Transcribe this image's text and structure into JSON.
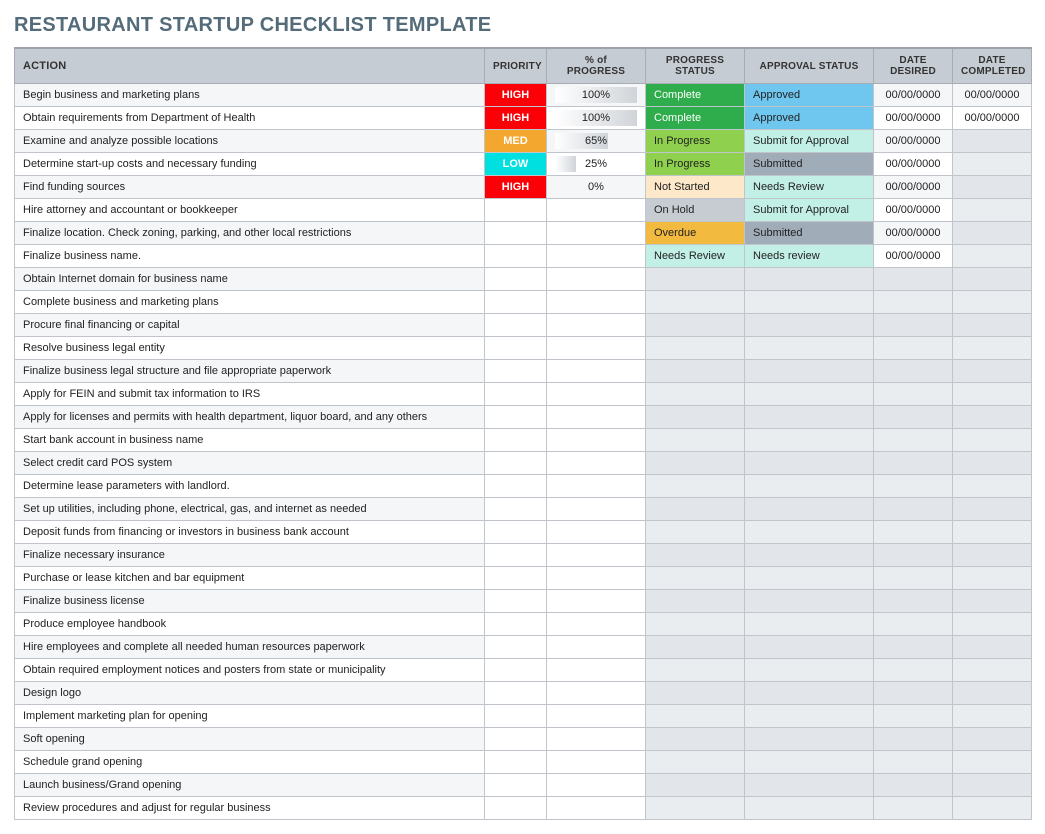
{
  "title": "RESTAURANT STARTUP CHECKLIST TEMPLATE",
  "headers": {
    "action": "ACTION",
    "priority": "PRIORITY",
    "progress": "% of PROGRESS",
    "progress_status": "PROGRESS STATUS",
    "approval_status": "APPROVAL STATUS",
    "date_desired": "DATE DESIRED",
    "date_completed": "DATE COMPLETED"
  },
  "rows": [
    {
      "action": "Begin business and marketing plans",
      "priority": "HIGH",
      "progress": 100,
      "progress_status": "Complete",
      "approval_status": "Approved",
      "date_desired": "00/00/0000",
      "date_completed": "00/00/0000"
    },
    {
      "action": "Obtain requirements from Department of Health",
      "priority": "HIGH",
      "progress": 100,
      "progress_status": "Complete",
      "approval_status": "Approved",
      "date_desired": "00/00/0000",
      "date_completed": "00/00/0000"
    },
    {
      "action": "Examine and analyze possible locations",
      "priority": "MED",
      "progress": 65,
      "progress_status": "In Progress",
      "approval_status": "Submit for Approval",
      "date_desired": "00/00/0000",
      "date_completed": ""
    },
    {
      "action": "Determine start-up costs and necessary funding",
      "priority": "LOW",
      "progress": 25,
      "progress_status": "In Progress",
      "approval_status": "Submitted",
      "date_desired": "00/00/0000",
      "date_completed": ""
    },
    {
      "action": "Find funding sources",
      "priority": "HIGH",
      "progress": 0,
      "progress_status": "Not Started",
      "approval_status": "Needs Review",
      "date_desired": "00/00/0000",
      "date_completed": ""
    },
    {
      "action": "Hire attorney and accountant or bookkeeper",
      "priority": "",
      "progress": null,
      "progress_status": "On Hold",
      "approval_status": "Submit for Approval",
      "date_desired": "00/00/0000",
      "date_completed": ""
    },
    {
      "action": "Finalize location. Check zoning, parking, and other local restrictions",
      "priority": "",
      "progress": null,
      "progress_status": "Overdue",
      "approval_status": "Submitted",
      "date_desired": "00/00/0000",
      "date_completed": ""
    },
    {
      "action": "Finalize business name.",
      "priority": "",
      "progress": null,
      "progress_status": "Needs Review",
      "approval_status": "Needs review",
      "date_desired": "00/00/0000",
      "date_completed": ""
    },
    {
      "action": "Obtain Internet domain for business name",
      "priority": "",
      "progress": null,
      "progress_status": "",
      "approval_status": "",
      "date_desired": "",
      "date_completed": ""
    },
    {
      "action": "Complete business and marketing plans",
      "priority": "",
      "progress": null,
      "progress_status": "",
      "approval_status": "",
      "date_desired": "",
      "date_completed": ""
    },
    {
      "action": "Procure final financing or capital",
      "priority": "",
      "progress": null,
      "progress_status": "",
      "approval_status": "",
      "date_desired": "",
      "date_completed": ""
    },
    {
      "action": "Resolve business legal entity",
      "priority": "",
      "progress": null,
      "progress_status": "",
      "approval_status": "",
      "date_desired": "",
      "date_completed": ""
    },
    {
      "action": "Finalize business legal structure and file appropriate paperwork",
      "priority": "",
      "progress": null,
      "progress_status": "",
      "approval_status": "",
      "date_desired": "",
      "date_completed": ""
    },
    {
      "action": "Apply for FEIN and submit tax information to IRS",
      "priority": "",
      "progress": null,
      "progress_status": "",
      "approval_status": "",
      "date_desired": "",
      "date_completed": ""
    },
    {
      "action": "Apply for licenses and permits with health department, liquor board, and any others",
      "priority": "",
      "progress": null,
      "progress_status": "",
      "approval_status": "",
      "date_desired": "",
      "date_completed": ""
    },
    {
      "action": "Start bank account in business name",
      "priority": "",
      "progress": null,
      "progress_status": "",
      "approval_status": "",
      "date_desired": "",
      "date_completed": ""
    },
    {
      "action": "Select credit card POS system",
      "priority": "",
      "progress": null,
      "progress_status": "",
      "approval_status": "",
      "date_desired": "",
      "date_completed": ""
    },
    {
      "action": "Determine lease parameters with landlord.",
      "priority": "",
      "progress": null,
      "progress_status": "",
      "approval_status": "",
      "date_desired": "",
      "date_completed": ""
    },
    {
      "action": "Set up utilities, including phone, electrical, gas, and internet as needed",
      "priority": "",
      "progress": null,
      "progress_status": "",
      "approval_status": "",
      "date_desired": "",
      "date_completed": ""
    },
    {
      "action": "Deposit funds from financing or investors in business bank account",
      "priority": "",
      "progress": null,
      "progress_status": "",
      "approval_status": "",
      "date_desired": "",
      "date_completed": ""
    },
    {
      "action": "Finalize necessary insurance",
      "priority": "",
      "progress": null,
      "progress_status": "",
      "approval_status": "",
      "date_desired": "",
      "date_completed": ""
    },
    {
      "action": "Purchase or lease kitchen and bar equipment",
      "priority": "",
      "progress": null,
      "progress_status": "",
      "approval_status": "",
      "date_desired": "",
      "date_completed": ""
    },
    {
      "action": "Finalize business license",
      "priority": "",
      "progress": null,
      "progress_status": "",
      "approval_status": "",
      "date_desired": "",
      "date_completed": ""
    },
    {
      "action": "Produce employee handbook",
      "priority": "",
      "progress": null,
      "progress_status": "",
      "approval_status": "",
      "date_desired": "",
      "date_completed": ""
    },
    {
      "action": "Hire employees and complete all needed human resources paperwork",
      "priority": "",
      "progress": null,
      "progress_status": "",
      "approval_status": "",
      "date_desired": "",
      "date_completed": ""
    },
    {
      "action": "Obtain required employment notices and posters from state or municipality",
      "priority": "",
      "progress": null,
      "progress_status": "",
      "approval_status": "",
      "date_desired": "",
      "date_completed": ""
    },
    {
      "action": "Design logo",
      "priority": "",
      "progress": null,
      "progress_status": "",
      "approval_status": "",
      "date_desired": "",
      "date_completed": ""
    },
    {
      "action": "Implement marketing plan for opening",
      "priority": "",
      "progress": null,
      "progress_status": "",
      "approval_status": "",
      "date_desired": "",
      "date_completed": ""
    },
    {
      "action": "Soft opening",
      "priority": "",
      "progress": null,
      "progress_status": "",
      "approval_status": "",
      "date_desired": "",
      "date_completed": ""
    },
    {
      "action": "Schedule grand opening",
      "priority": "",
      "progress": null,
      "progress_status": "",
      "approval_status": "",
      "date_desired": "",
      "date_completed": ""
    },
    {
      "action": "Launch business/Grand opening",
      "priority": "",
      "progress": null,
      "progress_status": "",
      "approval_status": "",
      "date_desired": "",
      "date_completed": ""
    },
    {
      "action": "Review procedures and adjust for regular business",
      "priority": "",
      "progress": null,
      "progress_status": "",
      "approval_status": "",
      "date_desired": "",
      "date_completed": ""
    }
  ]
}
